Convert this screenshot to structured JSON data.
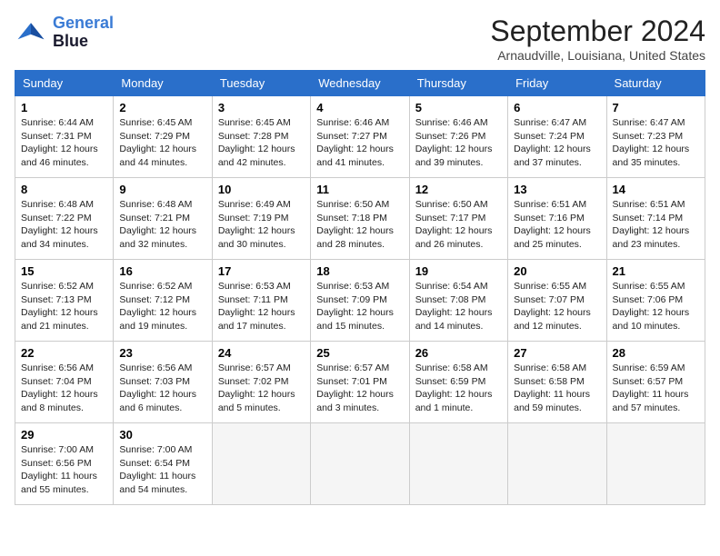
{
  "logo": {
    "line1": "General",
    "line2": "Blue"
  },
  "title": "September 2024",
  "location": "Arnaudville, Louisiana, United States",
  "weekdays": [
    "Sunday",
    "Monday",
    "Tuesday",
    "Wednesday",
    "Thursday",
    "Friday",
    "Saturday"
  ],
  "weeks": [
    [
      {
        "day": "1",
        "info": "Sunrise: 6:44 AM\nSunset: 7:31 PM\nDaylight: 12 hours\nand 46 minutes."
      },
      {
        "day": "2",
        "info": "Sunrise: 6:45 AM\nSunset: 7:29 PM\nDaylight: 12 hours\nand 44 minutes."
      },
      {
        "day": "3",
        "info": "Sunrise: 6:45 AM\nSunset: 7:28 PM\nDaylight: 12 hours\nand 42 minutes."
      },
      {
        "day": "4",
        "info": "Sunrise: 6:46 AM\nSunset: 7:27 PM\nDaylight: 12 hours\nand 41 minutes."
      },
      {
        "day": "5",
        "info": "Sunrise: 6:46 AM\nSunset: 7:26 PM\nDaylight: 12 hours\nand 39 minutes."
      },
      {
        "day": "6",
        "info": "Sunrise: 6:47 AM\nSunset: 7:24 PM\nDaylight: 12 hours\nand 37 minutes."
      },
      {
        "day": "7",
        "info": "Sunrise: 6:47 AM\nSunset: 7:23 PM\nDaylight: 12 hours\nand 35 minutes."
      }
    ],
    [
      {
        "day": "8",
        "info": "Sunrise: 6:48 AM\nSunset: 7:22 PM\nDaylight: 12 hours\nand 34 minutes."
      },
      {
        "day": "9",
        "info": "Sunrise: 6:48 AM\nSunset: 7:21 PM\nDaylight: 12 hours\nand 32 minutes."
      },
      {
        "day": "10",
        "info": "Sunrise: 6:49 AM\nSunset: 7:19 PM\nDaylight: 12 hours\nand 30 minutes."
      },
      {
        "day": "11",
        "info": "Sunrise: 6:50 AM\nSunset: 7:18 PM\nDaylight: 12 hours\nand 28 minutes."
      },
      {
        "day": "12",
        "info": "Sunrise: 6:50 AM\nSunset: 7:17 PM\nDaylight: 12 hours\nand 26 minutes."
      },
      {
        "day": "13",
        "info": "Sunrise: 6:51 AM\nSunset: 7:16 PM\nDaylight: 12 hours\nand 25 minutes."
      },
      {
        "day": "14",
        "info": "Sunrise: 6:51 AM\nSunset: 7:14 PM\nDaylight: 12 hours\nand 23 minutes."
      }
    ],
    [
      {
        "day": "15",
        "info": "Sunrise: 6:52 AM\nSunset: 7:13 PM\nDaylight: 12 hours\nand 21 minutes."
      },
      {
        "day": "16",
        "info": "Sunrise: 6:52 AM\nSunset: 7:12 PM\nDaylight: 12 hours\nand 19 minutes."
      },
      {
        "day": "17",
        "info": "Sunrise: 6:53 AM\nSunset: 7:11 PM\nDaylight: 12 hours\nand 17 minutes."
      },
      {
        "day": "18",
        "info": "Sunrise: 6:53 AM\nSunset: 7:09 PM\nDaylight: 12 hours\nand 15 minutes."
      },
      {
        "day": "19",
        "info": "Sunrise: 6:54 AM\nSunset: 7:08 PM\nDaylight: 12 hours\nand 14 minutes."
      },
      {
        "day": "20",
        "info": "Sunrise: 6:55 AM\nSunset: 7:07 PM\nDaylight: 12 hours\nand 12 minutes."
      },
      {
        "day": "21",
        "info": "Sunrise: 6:55 AM\nSunset: 7:06 PM\nDaylight: 12 hours\nand 10 minutes."
      }
    ],
    [
      {
        "day": "22",
        "info": "Sunrise: 6:56 AM\nSunset: 7:04 PM\nDaylight: 12 hours\nand 8 minutes."
      },
      {
        "day": "23",
        "info": "Sunrise: 6:56 AM\nSunset: 7:03 PM\nDaylight: 12 hours\nand 6 minutes."
      },
      {
        "day": "24",
        "info": "Sunrise: 6:57 AM\nSunset: 7:02 PM\nDaylight: 12 hours\nand 5 minutes."
      },
      {
        "day": "25",
        "info": "Sunrise: 6:57 AM\nSunset: 7:01 PM\nDaylight: 12 hours\nand 3 minutes."
      },
      {
        "day": "26",
        "info": "Sunrise: 6:58 AM\nSunset: 6:59 PM\nDaylight: 12 hours\nand 1 minute."
      },
      {
        "day": "27",
        "info": "Sunrise: 6:58 AM\nSunset: 6:58 PM\nDaylight: 11 hours\nand 59 minutes."
      },
      {
        "day": "28",
        "info": "Sunrise: 6:59 AM\nSunset: 6:57 PM\nDaylight: 11 hours\nand 57 minutes."
      }
    ],
    [
      {
        "day": "29",
        "info": "Sunrise: 7:00 AM\nSunset: 6:56 PM\nDaylight: 11 hours\nand 55 minutes."
      },
      {
        "day": "30",
        "info": "Sunrise: 7:00 AM\nSunset: 6:54 PM\nDaylight: 11 hours\nand 54 minutes."
      },
      {
        "day": "",
        "info": ""
      },
      {
        "day": "",
        "info": ""
      },
      {
        "day": "",
        "info": ""
      },
      {
        "day": "",
        "info": ""
      },
      {
        "day": "",
        "info": ""
      }
    ]
  ]
}
